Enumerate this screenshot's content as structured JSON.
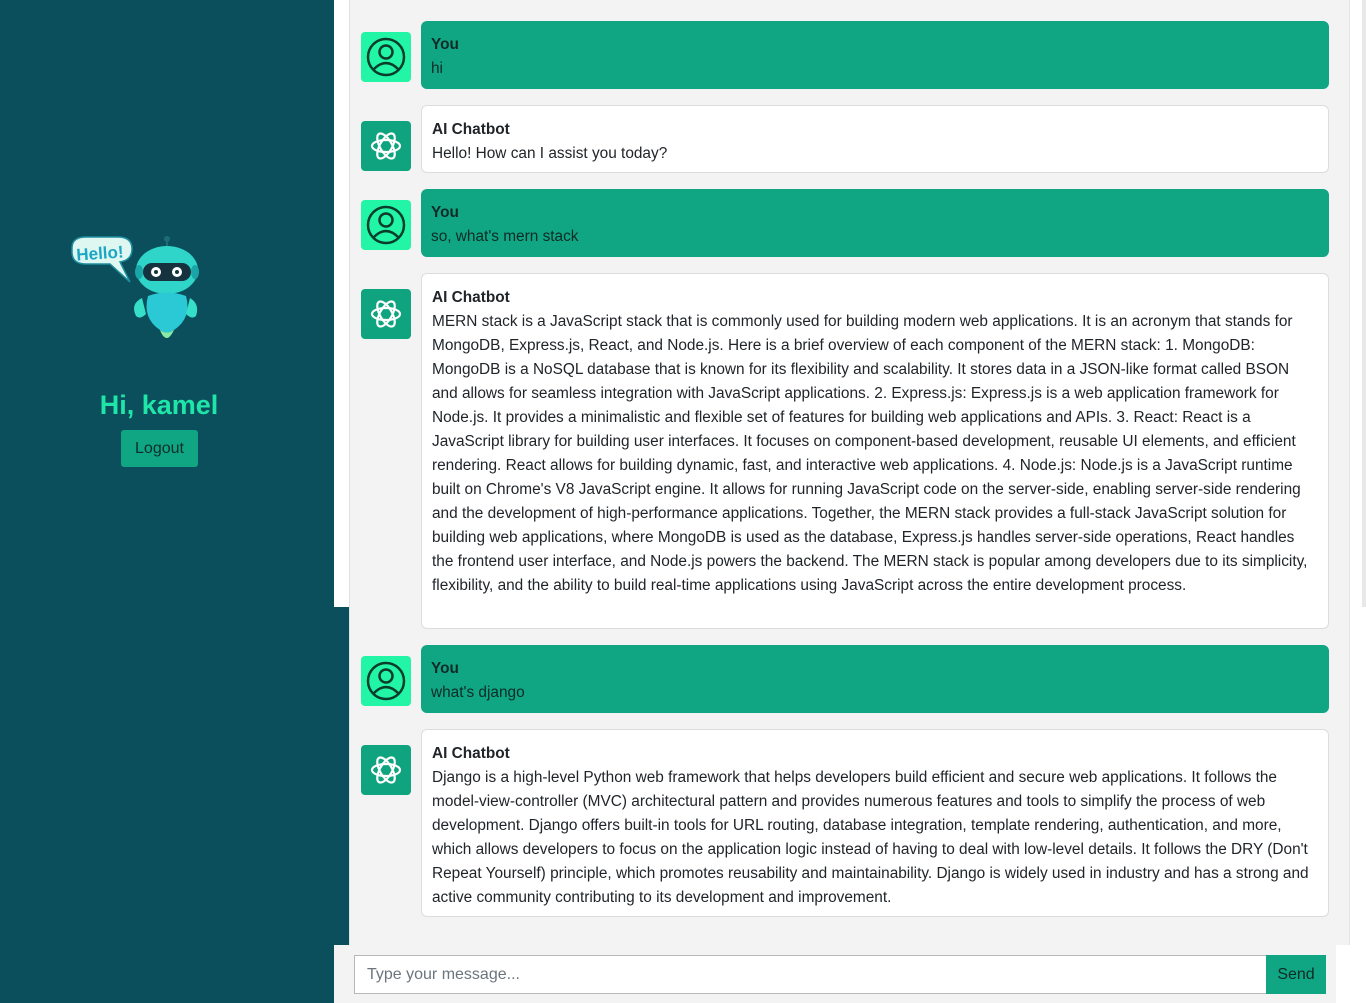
{
  "sidebar": {
    "bubble_text": "Hello!",
    "greeting": "Hi, kamel",
    "logout_label": "Logout"
  },
  "messages": [
    {
      "sender": "You",
      "role": "user",
      "text": "hi"
    },
    {
      "sender": "AI Chatbot",
      "role": "bot",
      "text": "Hello! How can I assist you today?"
    },
    {
      "sender": "You",
      "role": "user",
      "text": "so, what's mern stack"
    },
    {
      "sender": "AI Chatbot",
      "role": "bot",
      "text": "MERN stack is a JavaScript stack that is commonly used for building modern web applications. It is an acronym that stands for MongoDB, Express.js, React, and Node.js. Here is a brief overview of each component of the MERN stack: 1. MongoDB: MongoDB is a NoSQL database that is known for its flexibility and scalability. It stores data in a JSON-like format called BSON and allows for seamless integration with JavaScript applications. 2. Express.js: Express.js is a web application framework for Node.js. It provides a minimalistic and flexible set of features for building web applications and APIs. 3. React: React is a JavaScript library for building user interfaces. It focuses on component-based development, reusable UI elements, and efficient rendering. React allows for building dynamic, fast, and interactive web applications. 4. Node.js: Node.js is a JavaScript runtime built on Chrome's V8 JavaScript engine. It allows for running JavaScript code on the server-side, enabling server-side rendering and the development of high-performance applications. Together, the MERN stack provides a full-stack JavaScript solution for building web applications, where MongoDB is used as the database, Express.js handles server-side operations, React handles the frontend user interface, and Node.js powers the backend. The MERN stack is popular among developers due to its simplicity, flexibility, and the ability to build real-time applications using JavaScript across the entire development process."
    },
    {
      "sender": "You",
      "role": "user",
      "text": "what's django"
    },
    {
      "sender": "AI Chatbot",
      "role": "bot",
      "text": "Django is a high-level Python web framework that helps developers build efficient and secure web applications. It follows the model-view-controller (MVC) architectural pattern and provides numerous features and tools to simplify the process of web development. Django offers built-in tools for URL routing, database integration, template rendering, authentication, and more, which allows developers to focus on the application logic instead of having to deal with low-level details. It follows the DRY (Don't Repeat Yourself) principle, which promotes reusability and maintainability. Django is widely used in industry and has a strong and active community contributing to its development and improvement."
    }
  ],
  "composer": {
    "placeholder": "Type your message...",
    "value": "",
    "send_label": "Send"
  },
  "icons": {
    "user_avatar": "user-circle-icon",
    "bot_avatar": "openai-logo-icon"
  },
  "colors": {
    "sidebar_bg": "#0b4f5c",
    "accent": "#11a683",
    "greeting": "#1fe5a9",
    "user_avatar_bg": "#22f5a6",
    "chat_bg": "#f3f3f3"
  }
}
